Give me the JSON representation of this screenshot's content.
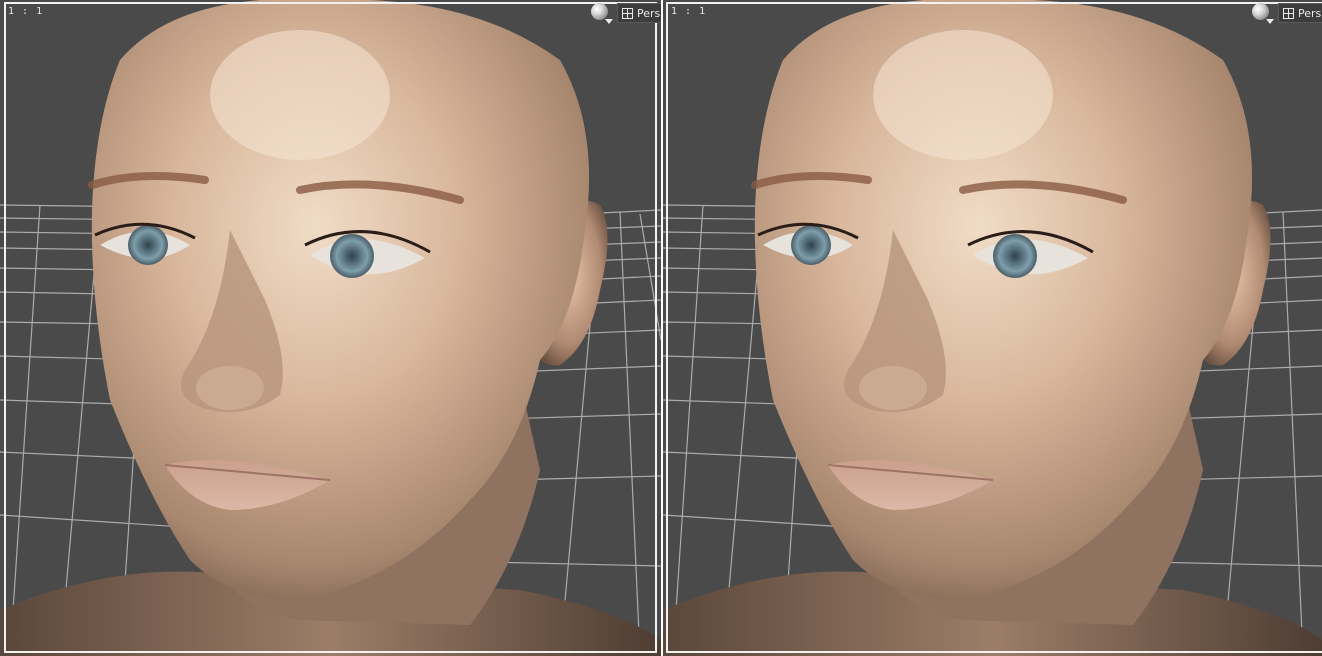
{
  "viewports": [
    {
      "ratio_label": "1 : 1",
      "camera_label": "Perspective",
      "icons": {
        "shading": "sphere-shading-icon",
        "camera": "grid-icon"
      }
    },
    {
      "ratio_label": "1 : 1",
      "camera_label": "Perspective",
      "icons": {
        "shading": "sphere-shading-icon",
        "camera": "grid-icon"
      }
    }
  ],
  "colors": {
    "background": "#4a4a4a",
    "grid_line": "#bdbdbd",
    "skin_light": "#e6c8ae",
    "skin_mid": "#c6a58c",
    "skin_dark": "#7a5f4e",
    "iris": "#6f8e9c",
    "brow": "#8a5a44",
    "lips": "#c99a88",
    "frame": "#f2f2f2"
  }
}
